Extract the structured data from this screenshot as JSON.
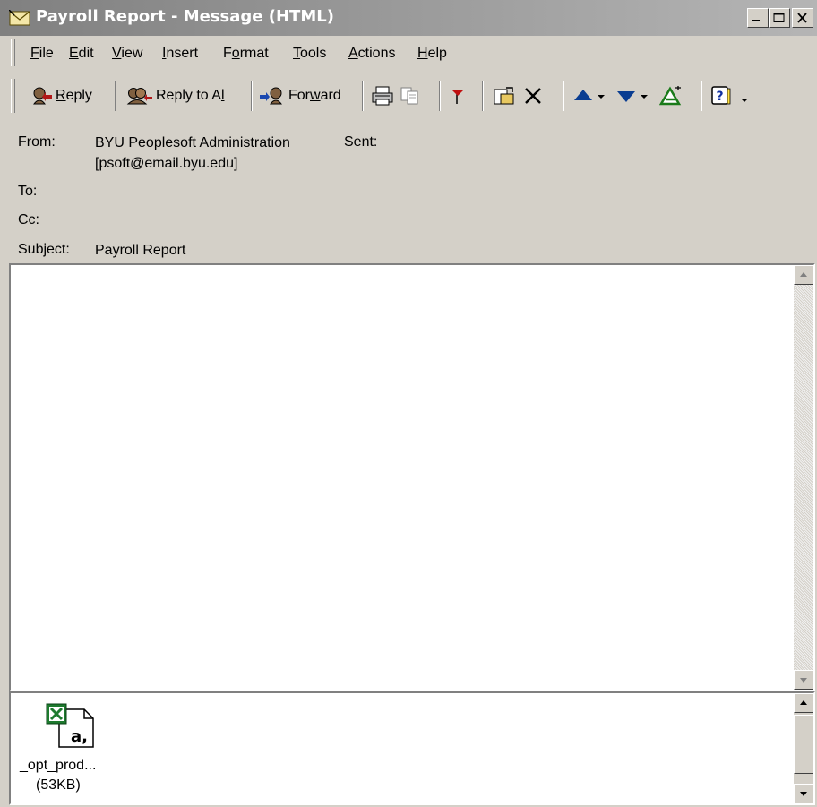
{
  "window": {
    "title": "Payroll Report - Message (HTML)"
  },
  "menu": {
    "items": [
      {
        "label_u": "F",
        "label_rest": "ile"
      },
      {
        "label_u": "E",
        "label_rest": "dit"
      },
      {
        "label_u": "V",
        "label_rest": "iew"
      },
      {
        "label_u": "I",
        "label_rest": "nsert"
      },
      {
        "label_pre": "F",
        "label_u": "o",
        "label_rest": "rmat"
      },
      {
        "label_u": "T",
        "label_rest": "ools"
      },
      {
        "label_u": "A",
        "label_rest": "ctions"
      },
      {
        "label_u": "H",
        "label_rest": "elp"
      }
    ]
  },
  "toolbar": {
    "reply_pre": "",
    "reply_u": "R",
    "reply_rest": "eply",
    "reply_all_pre": "Reply to A",
    "reply_all_u": "l",
    "reply_all_rest": "l",
    "forward_pre": "For",
    "forward_u": "w",
    "forward_rest": "ard"
  },
  "header": {
    "from_label": "From:",
    "from_name": "BYU Peoplesoft Administration",
    "from_email": "[psoft@email.byu.edu]",
    "sent_label": "Sent:",
    "to_label": "To:",
    "cc_label": "Cc:",
    "subject_label": "Subject:",
    "subject_value": "Payroll Report"
  },
  "attachment": {
    "name": "_opt_prod...",
    "size": "(53KB)"
  },
  "colors": {
    "chrome": "#d4d0c8",
    "title_gradient_start": "#808080",
    "excel_green": "#1d7a2e"
  }
}
